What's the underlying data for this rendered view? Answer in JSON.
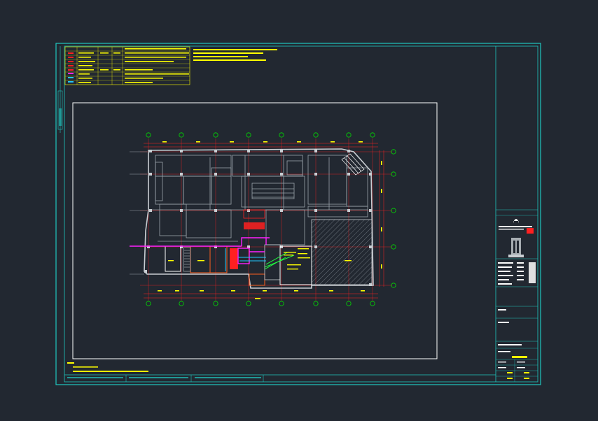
{
  "colors": {
    "background": "#222831",
    "frame": "#20c7c0",
    "inner_border": "#ffffff",
    "annotation": "#ffff00",
    "wall": "#c9ced3",
    "dimension": "#ff2020",
    "magenta": "#ff20ff",
    "green": "#20ff40",
    "axis_bubble": "#00e000"
  },
  "legend": {
    "icons": [
      "pipe-symbol-icon",
      "valve-symbol-icon",
      "sprinkler-symbol-icon",
      "hydrant-symbol-icon",
      "pump-symbol-icon",
      "alarm-symbol-icon",
      "detector-symbol-icon",
      "extinguisher-symbol-icon"
    ]
  },
  "title_block": {
    "logo_icon": "company-logo-icon",
    "building_icon": "building-emblem-icon"
  }
}
